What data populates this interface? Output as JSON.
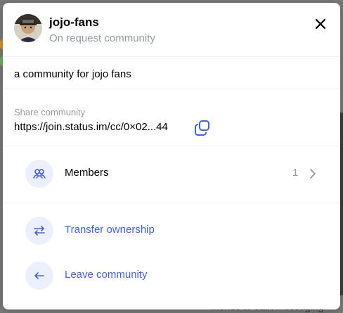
{
  "community": {
    "name": "jojo-fans",
    "access_type": "On request community",
    "description": "a community for jojo fans"
  },
  "share": {
    "label": "Share community",
    "link": "https://join.status.im/cc/0×02...44"
  },
  "members": {
    "label": "Members",
    "count": "1"
  },
  "actions": {
    "transfer": "Transfer ownership",
    "leave": "Leave community"
  },
  "background": {
    "footer_text": "friends to start messaging"
  },
  "colors": {
    "accent": "#4360df",
    "muted": "#939ba1",
    "icon_bg": "#eceffc"
  },
  "icons": {
    "avatar": "community-avatar",
    "close": "close-icon",
    "copy": "copy-icon",
    "members": "members-icon",
    "chevron": "chevron-right-icon",
    "transfer": "transfer-arrows-icon",
    "leave": "arrow-left-icon"
  }
}
